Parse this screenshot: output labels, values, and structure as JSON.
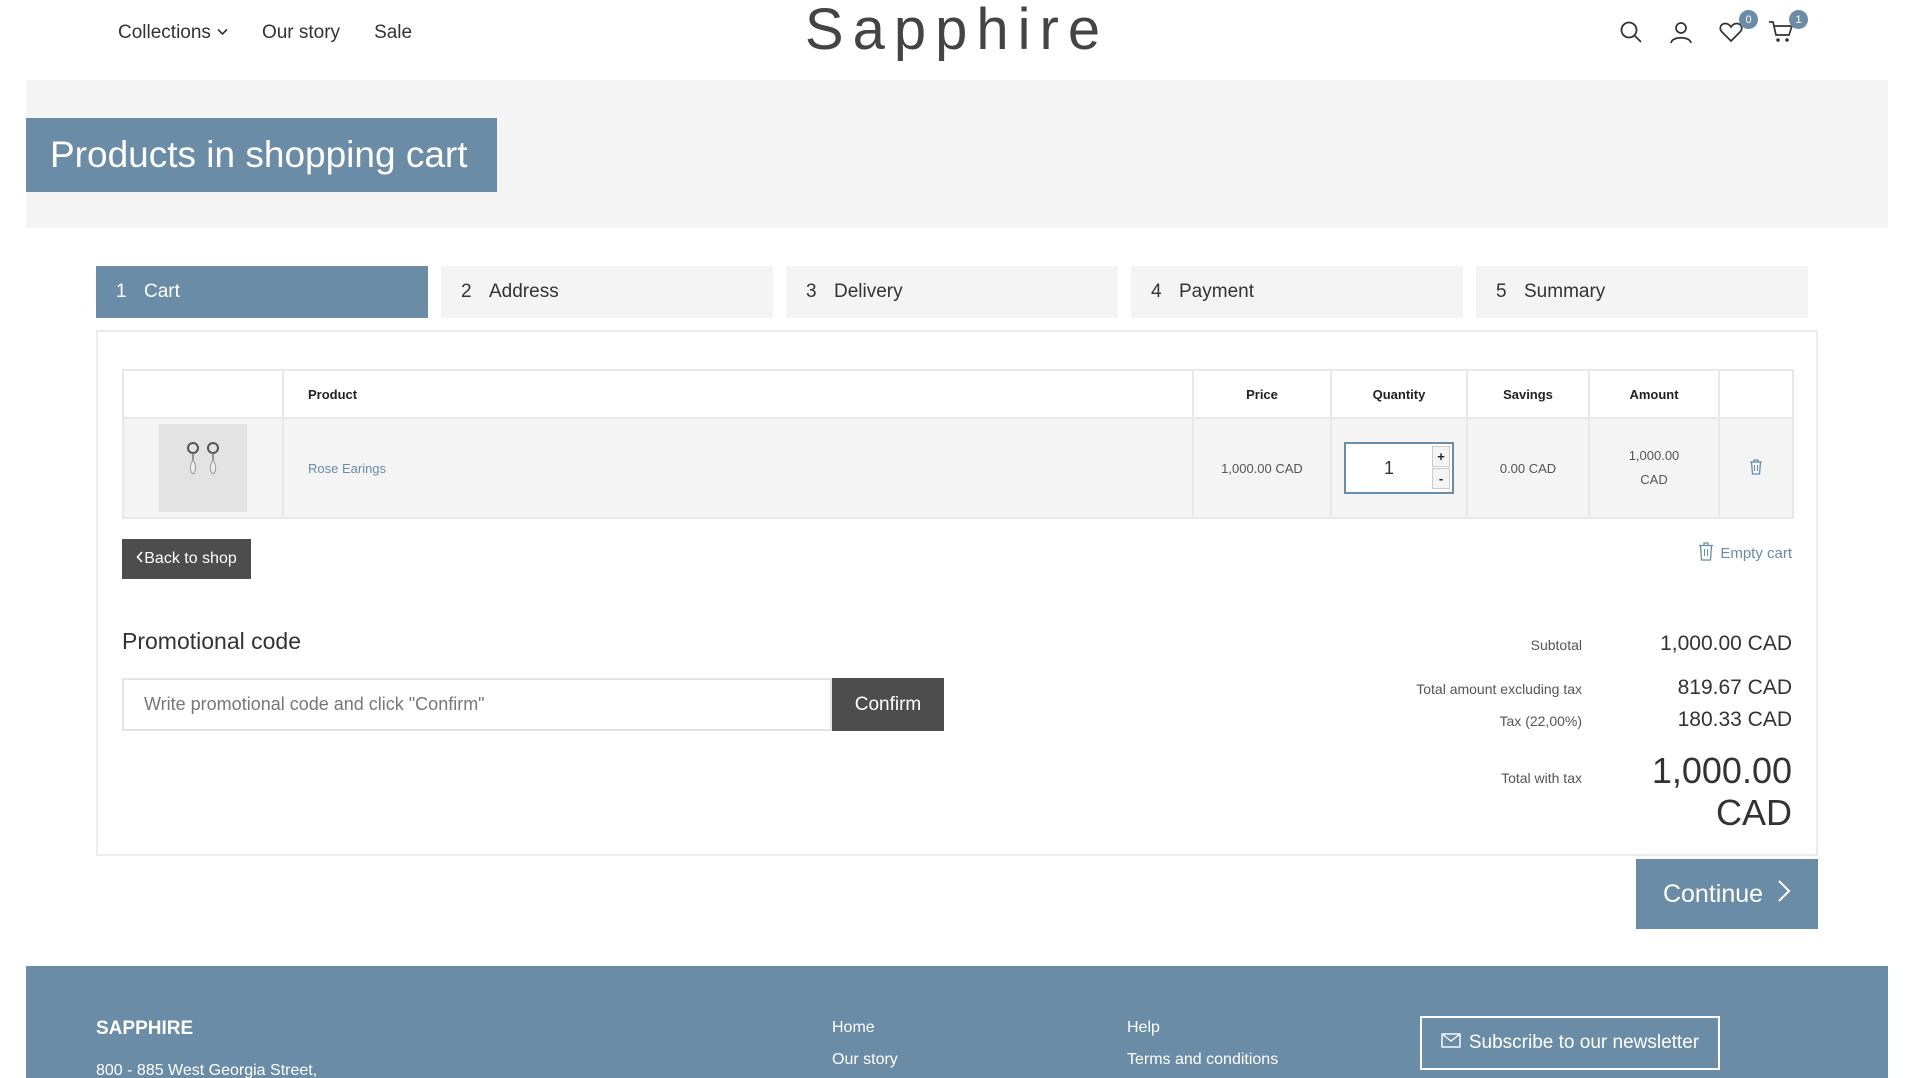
{
  "header": {
    "nav": [
      {
        "label": "Collections"
      },
      {
        "label": "Our story"
      },
      {
        "label": "Sale"
      }
    ],
    "logo": "Sapphire",
    "wishlist_count": "0",
    "cart_count": "1"
  },
  "banner": {
    "title": "Products in shopping cart"
  },
  "steps": [
    {
      "num": "1",
      "label": "Cart"
    },
    {
      "num": "2",
      "label": "Address"
    },
    {
      "num": "3",
      "label": "Delivery"
    },
    {
      "num": "4",
      "label": "Payment"
    },
    {
      "num": "5",
      "label": "Summary"
    }
  ],
  "cart_table": {
    "headers": {
      "product": "Product",
      "price": "Price",
      "quantity": "Quantity",
      "savings": "Savings",
      "amount": "Amount"
    },
    "rows": [
      {
        "product": "Rose Earings",
        "price": "1,000.00 CAD",
        "quantity": "1",
        "savings": "0.00 CAD",
        "amount_line1": "1,000.00",
        "amount_line2": "CAD"
      }
    ]
  },
  "actions": {
    "back": "Back to shop",
    "empty": "Empty cart",
    "qty_plus": "+",
    "qty_minus": "-"
  },
  "promo": {
    "title": "Promotional code",
    "placeholder": "Write promotional code and click \"Confirm\"",
    "button": "Confirm"
  },
  "totals": {
    "subtotal_label": "Subtotal",
    "subtotal": "1,000.00 CAD",
    "excl_label": "Total amount excluding tax",
    "excl": "819.67 CAD",
    "tax_label": "Tax (22,00%)",
    "tax": "180.33 CAD",
    "total_label": "Total with tax",
    "total": "1,000.00 CAD"
  },
  "continue": "Continue",
  "footer": {
    "brand": "SAPPHIRE",
    "address": "800 - 885 West Georgia Street,",
    "col1": [
      "Home",
      "Our story"
    ],
    "col2": [
      "Help",
      "Terms and conditions"
    ],
    "subscribe": "Subscribe to our newsletter"
  },
  "colors": {
    "accent": "#6a8ca6",
    "dark_button": "#4d4d4d",
    "panel": "#f4f4f4"
  }
}
